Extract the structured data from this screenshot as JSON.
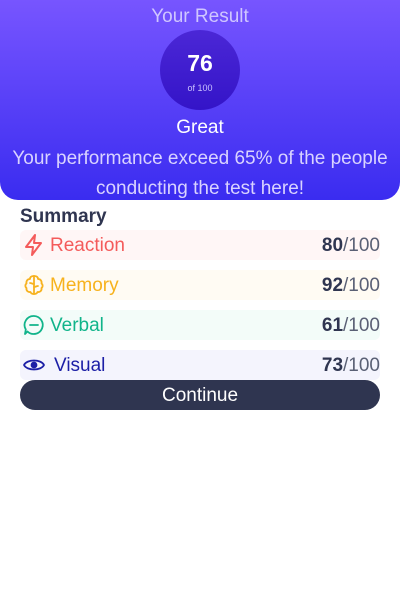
{
  "header": {
    "heading": "Your Result",
    "score": "76",
    "score_sub": "of 100",
    "rating": "Great",
    "description": "Your performance exceed 65% of the people conducting the test here!"
  },
  "summary": {
    "title": "Summary",
    "items": [
      {
        "label": "Reaction",
        "score": "80",
        "max": "/100",
        "icon": "lightning-icon",
        "color": "#f45b5b",
        "bg": "#fff6f6"
      },
      {
        "label": "Memory",
        "score": "92",
        "max": "/100",
        "icon": "brain-icon",
        "color": "#f7b21e",
        "bg": "#fffbf3"
      },
      {
        "label": "Verbal",
        "score": "61",
        "max": "/100",
        "icon": "chat-icon",
        "color": "#10b48a",
        "bg": "#f3fcf9"
      },
      {
        "label": "Visual",
        "score": "73",
        "max": "/100",
        "icon": "eye-icon",
        "color": "#1c1fa6",
        "bg": "#f4f4fd"
      }
    ]
  },
  "actions": {
    "continue_label": "Continue"
  }
}
